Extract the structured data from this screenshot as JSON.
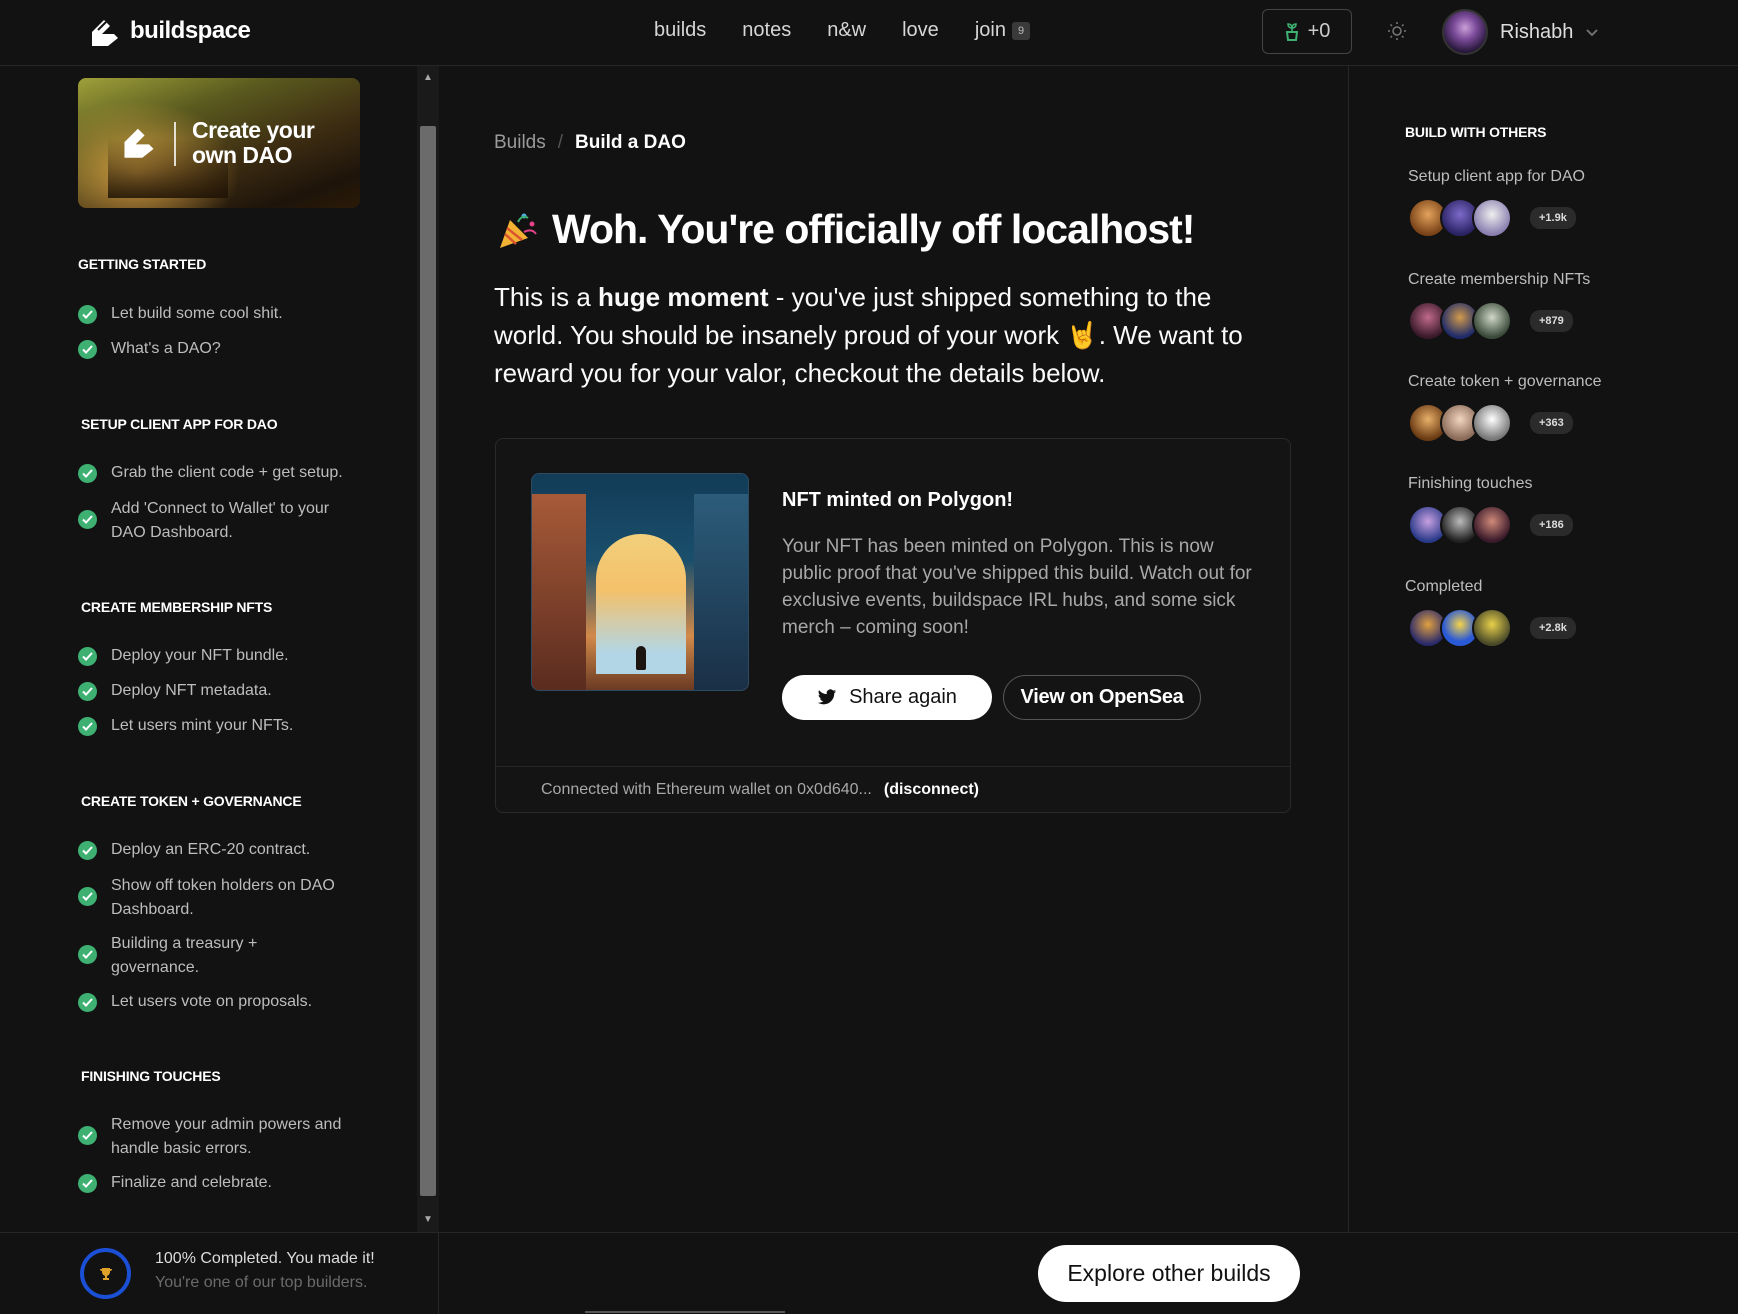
{
  "nav": {
    "brand": "buildspace",
    "links": [
      "builds",
      "notes",
      "n&w",
      "love",
      "join"
    ],
    "join_badge": "9",
    "points": "+0",
    "user_name": "Rishabh"
  },
  "sidebar": {
    "banner_text": "Create your own DAO",
    "sections": [
      {
        "title": "GETTING STARTED",
        "steps": [
          "Let build some cool shit.",
          "What's a DAO?"
        ]
      },
      {
        "title": "SETUP CLIENT APP FOR DAO",
        "steps": [
          "Grab the client code + get setup.",
          "Add 'Connect to Wallet' to your DAO Dashboard."
        ]
      },
      {
        "title": "CREATE MEMBERSHIP NFTS",
        "steps": [
          "Deploy your NFT bundle.",
          "Deploy NFT metadata.",
          "Let users mint your NFTs."
        ]
      },
      {
        "title": "CREATE TOKEN + GOVERNANCE",
        "steps": [
          "Deploy an ERC-20 contract.",
          "Show off token holders on DAO Dashboard.",
          "Building a treasury + governance.",
          "Let users vote on proposals."
        ]
      },
      {
        "title": "FINISHING TOUCHES",
        "steps": [
          "Remove your admin powers and handle basic errors.",
          "Finalize and celebrate."
        ]
      }
    ]
  },
  "main": {
    "breadcrumb": {
      "root": "Builds",
      "separator": "/",
      "current": "Build a DAO"
    },
    "headline": "Woh. You're officially off localhost!",
    "intro_pre": "This is a ",
    "intro_bold": "huge moment",
    "intro_post": " - you've just shipped something to the world. You should be insanely proud of your work 🤘. We want to reward you for your valor, checkout the details below.",
    "card": {
      "title": "NFT minted on Polygon!",
      "description": "Your NFT has been minted on Polygon. This is now public proof that you've shipped this build. Watch out for exclusive events, buildspace IRL hubs, and some sick merch – coming soon!",
      "share_label": "Share again",
      "opensea_label": "View on OpenSea",
      "wallet_text": "Connected with Ethereum wallet on 0x0d640...",
      "disconnect_label": "(disconnect)"
    }
  },
  "right": {
    "title": "BUILD WITH OTHERS",
    "groups": [
      {
        "label": "Setup client app for DAO",
        "count": "+1.9k"
      },
      {
        "label": "Create membership NFTs",
        "count": "+879"
      },
      {
        "label": "Create token + governance",
        "count": "+363"
      },
      {
        "label": "Finishing touches",
        "count": "+186"
      },
      {
        "label": "Completed",
        "count": "+2.8k"
      }
    ]
  },
  "bottom": {
    "progress": "100% Completed. You made it!",
    "progress_sub": "You're one of our top builders.",
    "explore_label": "Explore other builds"
  },
  "colors": {
    "background": "#121212",
    "check_green": "#3db072",
    "progress_ring": "#1a4fd6"
  }
}
